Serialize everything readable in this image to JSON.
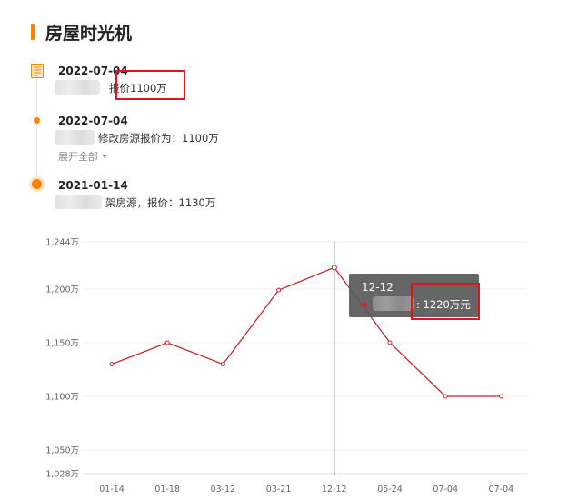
{
  "header": {
    "title": "房屋时光机"
  },
  "timeline": {
    "entries": [
      {
        "date": "2022-07-04",
        "text": "报价1100万"
      },
      {
        "date": "2022-07-04",
        "text": "修改房源报价为：1100万",
        "expand_label": "展开全部"
      },
      {
        "date": "2021-01-14",
        "text": "架房源，报价：1130万"
      }
    ]
  },
  "colors": {
    "accent": "#ff8200",
    "line": "#c8282e",
    "highlight_box": "#e0141e",
    "tooltip_bg": "#5a5a5a"
  },
  "chart_data": {
    "type": "line",
    "categories": [
      "01-14",
      "01-18",
      "03-12",
      "03-21",
      "12-12",
      "05-24",
      "07-04",
      "07-04"
    ],
    "series": [
      {
        "values": [
          1130,
          1150,
          1130,
          1199,
          1220,
          1150,
          1100,
          1100
        ]
      }
    ],
    "y_ticks": [
      "1,244万",
      "1,200万",
      "1,150万",
      "1,100万",
      "1,050万",
      "1,028万"
    ],
    "y_tick_values": [
      1244,
      1200,
      1150,
      1100,
      1050,
      1028
    ],
    "ylim": [
      1028,
      1244
    ],
    "grid": "horizontal",
    "crosshair_category": "12-12",
    "tooltip": {
      "date": "12-12",
      "value_text": ": 1220万元"
    }
  }
}
